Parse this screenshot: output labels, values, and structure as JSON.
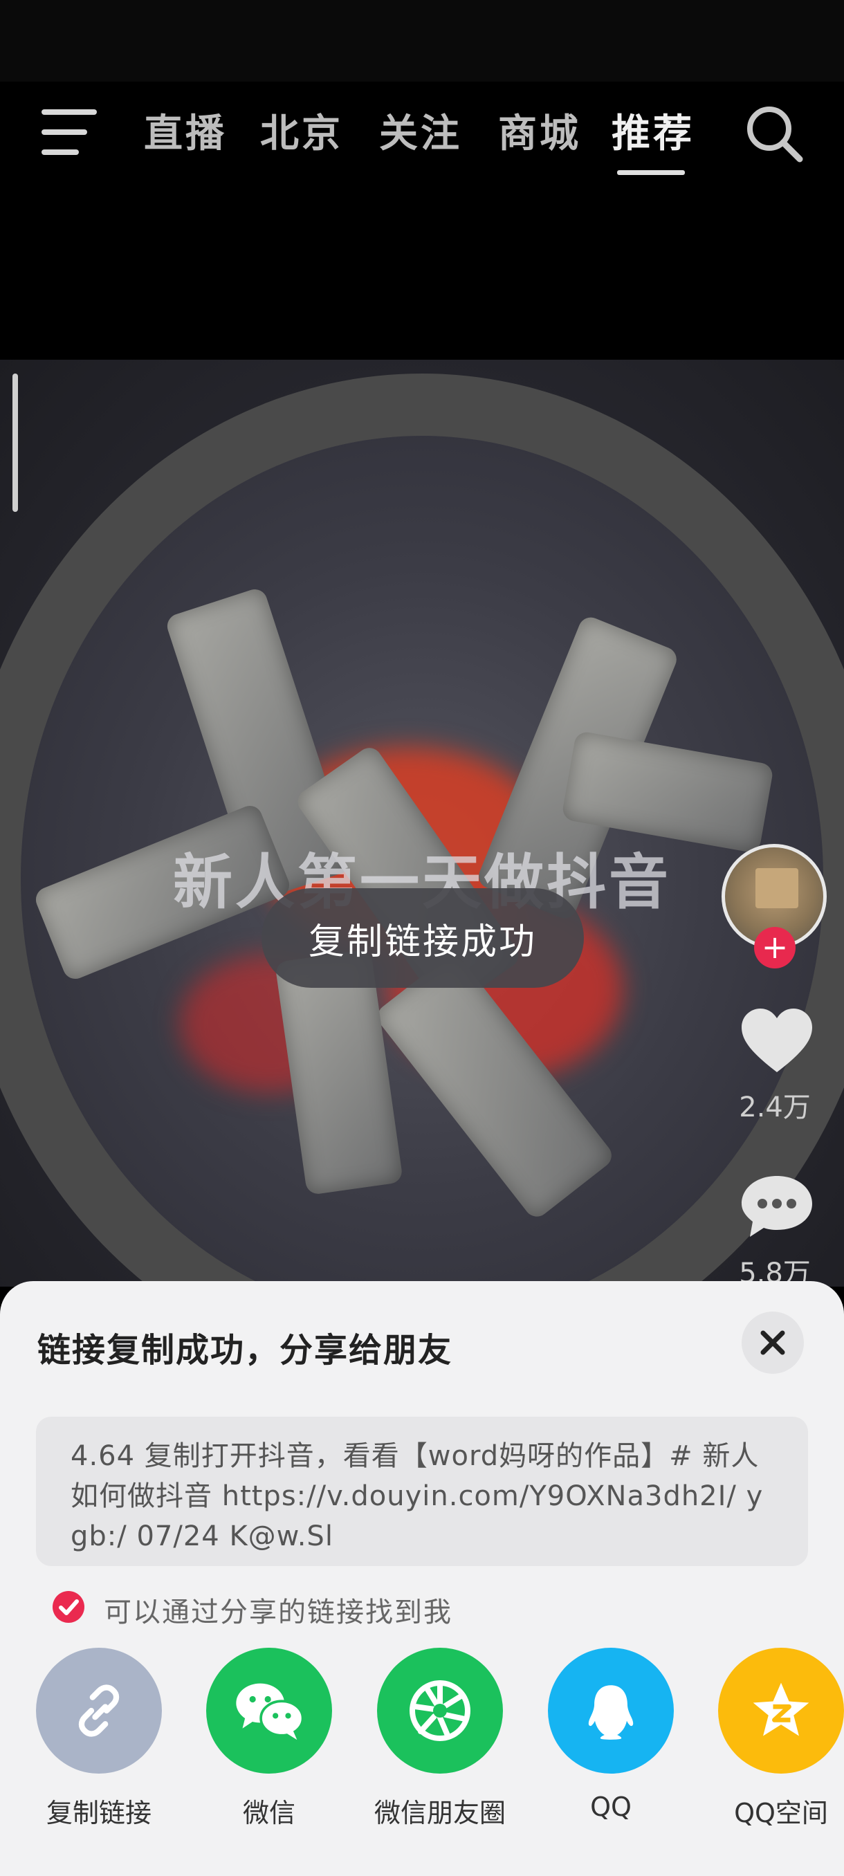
{
  "nav": {
    "tabs": [
      {
        "label": "直播"
      },
      {
        "label": "北京"
      },
      {
        "label": "关注"
      },
      {
        "label": "商城"
      },
      {
        "label": "推荐"
      }
    ],
    "active_tab": "推荐"
  },
  "video": {
    "caption": "新人第一天做抖音",
    "toast": "复制链接成功"
  },
  "right_rail": {
    "like_count": "2.4万",
    "comment_count": "5.8万"
  },
  "share_sheet": {
    "title": "链接复制成功，分享给朋友",
    "link_text": "4.64 复制打开抖音，看看【word妈呀的作品】# 新人如何做抖音  https://v.douyin.com/Y9OXNa3dh2I/ ygb:/ 07/24 K@w.Sl",
    "checkbox_label": "可以通过分享的链接找到我",
    "options": [
      {
        "label": "复制链接",
        "color": "#aab4c8"
      },
      {
        "label": "微信",
        "color": "#1bc15c"
      },
      {
        "label": "微信朋友圈",
        "color": "#1bc15c"
      },
      {
        "label": "QQ",
        "color": "#16b4f2"
      },
      {
        "label": "QQ空间",
        "color": "#fcbb0c"
      }
    ]
  }
}
